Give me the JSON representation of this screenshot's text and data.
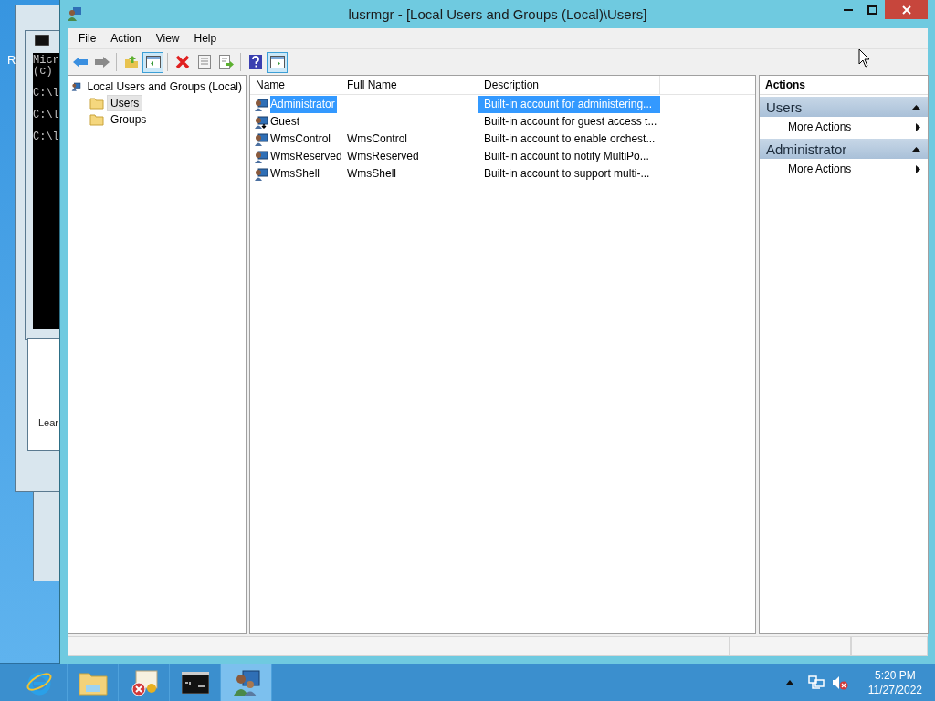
{
  "background_windows": {
    "desktop_letter": "R",
    "console_lines": [
      "Micr",
      "(c)",
      "C:\\l",
      "C:\\l",
      "C:\\l"
    ],
    "dialog_text": "Lear"
  },
  "window": {
    "title": "lusrmgr - [Local Users and Groups (Local)\\Users]"
  },
  "menu": [
    "File",
    "Action",
    "View",
    "Help"
  ],
  "toolbar": [
    [
      {
        "kind": "back",
        "pressed": false
      },
      {
        "kind": "forward",
        "pressed": false
      }
    ],
    [
      {
        "kind": "up",
        "pressed": false
      },
      {
        "kind": "tree",
        "pressed": true
      }
    ],
    [
      {
        "kind": "delete",
        "pressed": false
      },
      {
        "kind": "properties",
        "pressed": false
      },
      {
        "kind": "export",
        "pressed": false
      }
    ],
    [
      {
        "kind": "help",
        "pressed": false
      },
      {
        "kind": "actionpane",
        "pressed": true
      }
    ]
  ],
  "tree": {
    "label": "Local Users and Groups (Local)",
    "children": [
      {
        "label": "Users",
        "selected": true
      },
      {
        "label": "Groups",
        "selected": false
      }
    ]
  },
  "table": {
    "columns": [
      "Name",
      "Full Name",
      "Description"
    ],
    "rows": [
      {
        "cells": [
          "Administrator",
          "",
          "Built-in account for administering..."
        ],
        "selected": true,
        "disabled": false
      },
      {
        "cells": [
          "Guest",
          "",
          "Built-in account for guest access t..."
        ],
        "selected": false,
        "disabled": true
      },
      {
        "cells": [
          "WmsControl",
          "WmsControl",
          "Built-in account to enable orchest..."
        ],
        "selected": false,
        "disabled": false
      },
      {
        "cells": [
          "WmsReserved",
          "WmsReserved",
          "Built-in account to notify MultiPo..."
        ],
        "selected": false,
        "disabled": false
      },
      {
        "cells": [
          "WmsShell",
          "WmsShell",
          "Built-in account to support multi-..."
        ],
        "selected": false,
        "disabled": false
      }
    ]
  },
  "actions": {
    "title": "Actions",
    "sections": [
      {
        "title": "Users",
        "expanded": true,
        "items": [
          "More Actions"
        ]
      },
      {
        "title": "Administrator",
        "expanded": true,
        "items": [
          "More Actions"
        ]
      }
    ]
  },
  "taskbar": {
    "apps": [
      {
        "kind": "ie",
        "selected": false
      },
      {
        "kind": "explorer",
        "selected": false
      },
      {
        "kind": "certificate",
        "selected": false
      },
      {
        "kind": "console",
        "selected": false
      },
      {
        "kind": "users",
        "selected": true
      }
    ],
    "clock": {
      "time": "5:20 PM",
      "date": "11/27/2022"
    }
  }
}
